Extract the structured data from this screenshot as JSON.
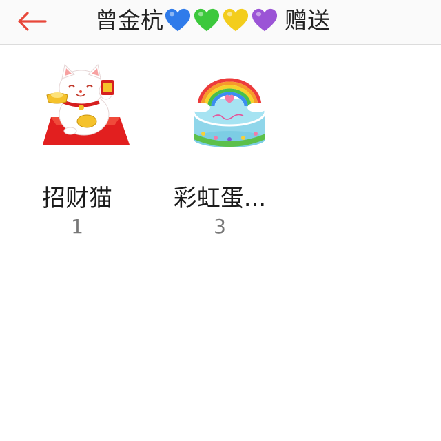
{
  "header": {
    "back_icon": "back-arrow-icon",
    "title_name": "曾金杭",
    "hearts": [
      {
        "name": "blue-heart-icon",
        "color": "#2f7bea"
      },
      {
        "name": "green-heart-icon",
        "color": "#3cc83c"
      },
      {
        "name": "yellow-heart-icon",
        "color": "#f3cd1c"
      },
      {
        "name": "purple-heart-icon",
        "color": "#9b54d6"
      }
    ],
    "title_action": "赠送"
  },
  "gifts": [
    {
      "name": "招财猫",
      "count": "1",
      "icon": "lucky-cat-icon"
    },
    {
      "name": "彩虹蛋...",
      "count": "3",
      "icon": "rainbow-cake-icon"
    }
  ],
  "colors": {
    "accent": "#e8473a",
    "header_bg": "#fafafa"
  }
}
